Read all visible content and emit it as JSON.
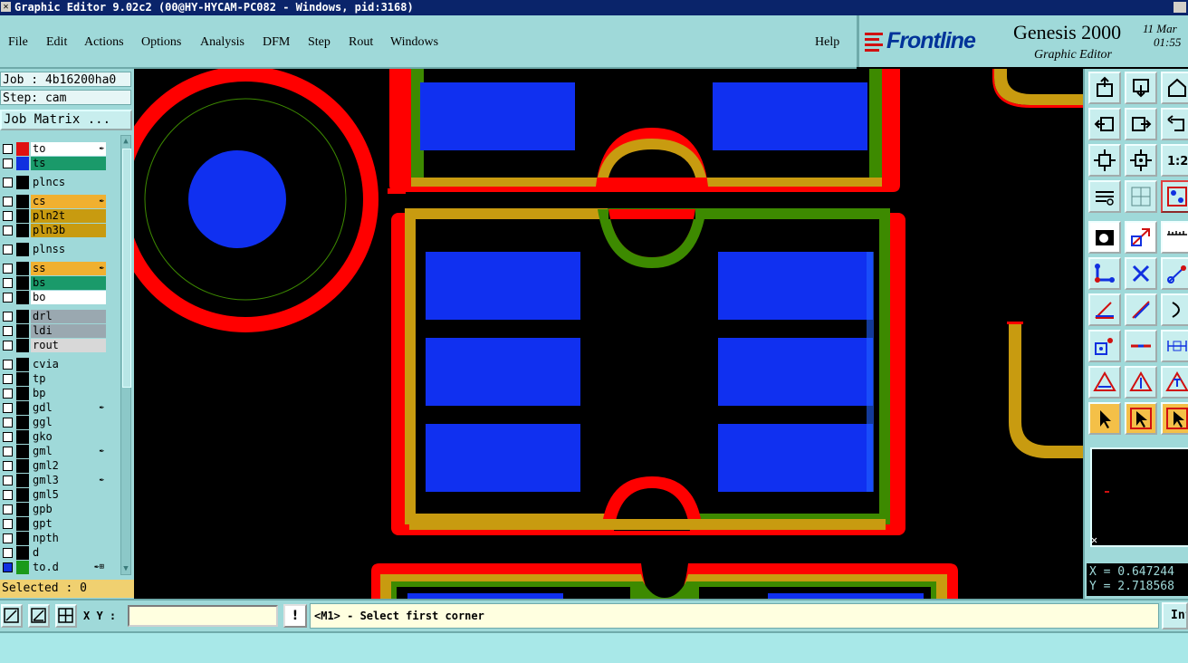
{
  "window": {
    "title": "Graphic Editor 9.02c2 (00@HY-HYCAM-PC082 - Windows, pid:3168)"
  },
  "menu": {
    "file": "File",
    "edit": "Edit",
    "actions": "Actions",
    "options": "Options",
    "analysis": "Analysis",
    "dfm": "DFM",
    "step": "Step",
    "rout": "Rout",
    "windows": "Windows",
    "help": "Help"
  },
  "brand": {
    "logo": "Frontline",
    "product": "Genesis 2000",
    "subtitle": "Graphic Editor",
    "date": "11 Mar",
    "time": "01:55"
  },
  "job": {
    "job_label": "Job : 4b16200ha0",
    "step_label": "Step: cam",
    "matrix_button": "Job Matrix ..."
  },
  "layers": [
    {
      "name": "to",
      "color": "#ffffff",
      "swatch": "#e01010",
      "flag": "✒"
    },
    {
      "name": "ts",
      "color": "#1a9a6a",
      "swatch": "#1030e0",
      "flag": ""
    },
    {
      "name": "plncs",
      "color": "#9fd9d9",
      "swatch": "#000000",
      "flag": ""
    },
    {
      "name": "cs",
      "color": "#f0b030",
      "swatch": "#000000",
      "flag": "✒"
    },
    {
      "name": "pln2t",
      "color": "#c89b10",
      "swatch": "#000000",
      "flag": ""
    },
    {
      "name": "pln3b",
      "color": "#c89b10",
      "swatch": "#000000",
      "flag": ""
    },
    {
      "name": "plnss",
      "color": "#9fd9d9",
      "swatch": "#000000",
      "flag": ""
    },
    {
      "name": "ss",
      "color": "#f0b030",
      "swatch": "#000000",
      "flag": "✒"
    },
    {
      "name": "bs",
      "color": "#1a9a6a",
      "swatch": "#000000",
      "flag": ""
    },
    {
      "name": "bo",
      "color": "#ffffff",
      "swatch": "#000000",
      "flag": ""
    },
    {
      "name": "drl",
      "color": "#9aa8b0",
      "swatch": "#000000",
      "flag": ""
    },
    {
      "name": "ldi",
      "color": "#9aa8b0",
      "swatch": "#000000",
      "flag": ""
    },
    {
      "name": "rout",
      "color": "#d8d8d8",
      "swatch": "#000000",
      "flag": ""
    },
    {
      "name": "cvia",
      "color": "#9fd9d9",
      "swatch": "#000000",
      "flag": ""
    },
    {
      "name": "tp",
      "color": "#9fd9d9",
      "swatch": "#000000",
      "flag": ""
    },
    {
      "name": "bp",
      "color": "#9fd9d9",
      "swatch": "#000000",
      "flag": ""
    },
    {
      "name": "gdl",
      "color": "#9fd9d9",
      "swatch": "#000000",
      "flag": "✒"
    },
    {
      "name": "ggl",
      "color": "#9fd9d9",
      "swatch": "#000000",
      "flag": ""
    },
    {
      "name": "gko",
      "color": "#9fd9d9",
      "swatch": "#000000",
      "flag": ""
    },
    {
      "name": "gml",
      "color": "#9fd9d9",
      "swatch": "#000000",
      "flag": "✒"
    },
    {
      "name": "gml2",
      "color": "#9fd9d9",
      "swatch": "#000000",
      "flag": ""
    },
    {
      "name": "gml3",
      "color": "#9fd9d9",
      "swatch": "#000000",
      "flag": "✒"
    },
    {
      "name": "gml5",
      "color": "#9fd9d9",
      "swatch": "#000000",
      "flag": ""
    },
    {
      "name": "gpb",
      "color": "#9fd9d9",
      "swatch": "#000000",
      "flag": ""
    },
    {
      "name": "gpt",
      "color": "#9fd9d9",
      "swatch": "#000000",
      "flag": ""
    },
    {
      "name": "npth",
      "color": "#9fd9d9",
      "swatch": "#000000",
      "flag": ""
    },
    {
      "name": "d",
      "color": "#9fd9d9",
      "swatch": "#000000",
      "flag": ""
    },
    {
      "name": "to.d",
      "color": "#9fd9d9",
      "swatch": "#1a9a1a",
      "flag": "✒⊞"
    }
  ],
  "selected_label": "Selected : 0",
  "coords": {
    "x": "X = 0.647244",
    "y": "Y = 2.718568"
  },
  "bottom": {
    "xy_label": "X Y :",
    "xy_value": "",
    "warn": "!",
    "status": "<M1> - Select first corner",
    "info_button": "Inf"
  },
  "colors": {
    "bg": "#9fd9d9",
    "top_layer": "#ff0000",
    "pad": "#1030f0",
    "mask": "#c89b10",
    "soldermask_green": "#3d8a00",
    "canvas": "#000000"
  }
}
